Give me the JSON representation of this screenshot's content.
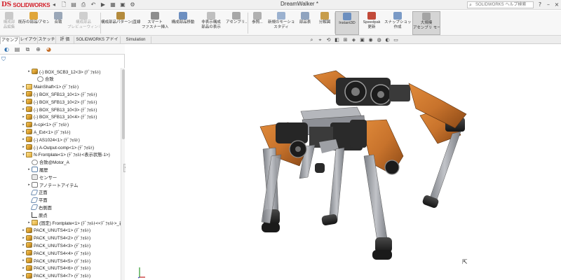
{
  "app": {
    "logo_ds": "DS",
    "logo_name": "SOLIDWORKS",
    "document_title": "DreamWalker *",
    "search_placeholder": "SOLIDWORKS ヘルプ検索"
  },
  "quick_access": [
    {
      "icon": "arrow-left-icon",
      "glyph": "◂"
    },
    {
      "icon": "new-doc-icon",
      "glyph": "🗋"
    },
    {
      "icon": "open-icon",
      "glyph": "▤"
    },
    {
      "icon": "print-icon",
      "glyph": "⎙"
    },
    {
      "icon": "undo-icon",
      "glyph": "↶"
    },
    {
      "icon": "select-icon",
      "glyph": "▶"
    },
    {
      "icon": "rebuild-icon",
      "glyph": "▦"
    },
    {
      "icon": "save-icon",
      "glyph": "▣"
    },
    {
      "icon": "options-icon",
      "glyph": "⚙"
    }
  ],
  "ribbon": {
    "buttons": [
      {
        "id": "edit-component",
        "line1": "構成部",
        "line2": "品編集",
        "disabled": true,
        "icon_color": "#c9c9c9"
      },
      {
        "id": "insert-component",
        "line1": "既存の部品/アセンブリ",
        "line2": "",
        "disabled": false,
        "icon_color": "#e0a63a"
      },
      {
        "id": "mate",
        "line1": "合致",
        "line2": "",
        "disabled": false,
        "icon_color": "#9aa7b8"
      },
      {
        "id": "component-preview",
        "line1": "構成部品",
        "line2": "プレビューウィンドウ",
        "disabled": true,
        "icon_color": "#cfcfcf"
      },
      {
        "id": "linear-pattern",
        "line1": "構成部品パターン(直線パターン)",
        "line2": "",
        "disabled": false,
        "icon_color": "#b48b3d"
      },
      {
        "id": "smart-fasteners",
        "line1": "スマート",
        "line2": "ファスナー挿入",
        "disabled": false,
        "icon_color": "#8d8d8d"
      },
      {
        "id": "move-component",
        "line1": "構成部品移動",
        "line2": "",
        "disabled": false,
        "icon_color": "#6d8fc0"
      },
      {
        "id": "show-hidden",
        "line1": "非表示構成",
        "line2": "部品の表示",
        "disabled": false,
        "icon_color": "#bfbfbf"
      },
      {
        "id": "assembly-features",
        "line1": "アセンブリ...",
        "line2": "",
        "disabled": false,
        "icon_color": "#a7a7a7"
      },
      {
        "id": "reference",
        "line1": "参照...",
        "line2": "",
        "disabled": false,
        "icon_color": "#b0b0b0"
      },
      {
        "id": "new-motion-study",
        "line1": "新規のモーション",
        "line2": "スタディ",
        "disabled": false,
        "icon_color": "#9bb1cf"
      },
      {
        "id": "bom",
        "line1": "部品表",
        "line2": "",
        "disabled": false,
        "icon_color": "#8fa3bf"
      },
      {
        "id": "exploded-view",
        "line1": "分解図",
        "line2": "",
        "disabled": false,
        "icon_color": "#c79d4b"
      },
      {
        "id": "instant3d",
        "line1": "Instant3D",
        "line2": "",
        "disabled": false,
        "icon_color": "#6c8fbf",
        "active": true
      },
      {
        "id": "speedpak",
        "line1": "Speedpak",
        "line2": "更新",
        "disabled": false,
        "icon_color": "#c24a3a"
      },
      {
        "id": "snapshot",
        "line1": "スナップショット",
        "line2": "作成",
        "disabled": false,
        "icon_color": "#7a9ac6"
      },
      {
        "id": "large-assembly",
        "line1": "大規模",
        "line2": "アセンブリ モード",
        "disabled": false,
        "icon_color": "#a4a4a4",
        "active": true
      }
    ]
  },
  "tabs": [
    "アセンブリ",
    "レイアウト",
    "スケッチ",
    "評 価",
    "SOLIDWORKS アドイン",
    "Simulation"
  ],
  "panel_tabs": [
    {
      "icon": "feature-manager-icon",
      "glyph": "◐",
      "color": "#2e6fae"
    },
    {
      "icon": "property-manager-icon",
      "glyph": "▤",
      "color": "#555"
    },
    {
      "icon": "configuration-manager-icon",
      "glyph": "⧉",
      "color": "#555"
    },
    {
      "icon": "dimxpert-icon",
      "glyph": "⊕",
      "color": "#555"
    },
    {
      "icon": "display-manager-icon",
      "glyph": "◕",
      "color": "#c46f2a"
    }
  ],
  "tree": [
    {
      "label": "(-) BOX_SCB3_12<3> (ﾃﾞﾌｫﾙﾄ)",
      "indent": 1,
      "arrow": "▸",
      "icon": "asm"
    },
    {
      "label": "合致",
      "indent": 2,
      "arrow": "",
      "icon": "mate"
    },
    {
      "label": "MainShaft<1> (ﾃﾞﾌｫﾙﾄ)",
      "indent": 0,
      "arrow": "▸",
      "icon": "part"
    },
    {
      "label": "(-) BOX_SFB13_10<1> (ﾃﾞﾌｫﾙﾄ)",
      "indent": 0,
      "arrow": "▸",
      "icon": "asm"
    },
    {
      "label": "(-) BOX_SFB13_10<2> (ﾃﾞﾌｫﾙﾄ)",
      "indent": 0,
      "arrow": "▸",
      "icon": "asm"
    },
    {
      "label": "(-) BOX_SFB13_10<3> (ﾃﾞﾌｫﾙﾄ)",
      "indent": 0,
      "arrow": "▸",
      "icon": "asm"
    },
    {
      "label": "(-) BOX_SFB13_10<4> (ﾃﾞﾌｫﾙﾄ)",
      "indent": 0,
      "arrow": "▸",
      "icon": "asm"
    },
    {
      "label": "A-cpi<1> (ﾃﾞﾌｫﾙﾄ)",
      "indent": 0,
      "arrow": "▸",
      "icon": "asm"
    },
    {
      "label": "A_Ext<1> (ﾃﾞﾌｫﾙﾄ)",
      "indent": 0,
      "arrow": "▸",
      "icon": "asm"
    },
    {
      "label": "(-) AS1024<1> (ﾃﾞﾌｫﾙﾄ)",
      "indent": 0,
      "arrow": "▸",
      "icon": "asm"
    },
    {
      "label": "(-) A-Output-comp<1> (ﾃﾞﾌｫﾙﾄ)",
      "indent": 0,
      "arrow": "▸",
      "icon": "asm"
    },
    {
      "label": "N-Frontplate<1> (ﾃﾞﾌｫﾙﾄ<表示状態-1>)",
      "indent": 0,
      "arrow": "▾",
      "icon": "part"
    },
    {
      "label": "合致@Motor_A",
      "indent": 1,
      "arrow": "",
      "icon": "mate"
    },
    {
      "label": "履歴",
      "indent": 1,
      "arrow": "▸",
      "icon": "hist"
    },
    {
      "label": "センサー",
      "indent": 1,
      "arrow": "",
      "icon": "sens"
    },
    {
      "label": "アノテートアイテム",
      "indent": 1,
      "arrow": "▸",
      "icon": "note"
    },
    {
      "label": "正面",
      "indent": 1,
      "arrow": "",
      "icon": "plane"
    },
    {
      "label": "平面",
      "indent": 1,
      "arrow": "",
      "icon": "plane"
    },
    {
      "label": "右側面",
      "indent": 1,
      "arrow": "",
      "icon": "plane"
    },
    {
      "label": "原点",
      "indent": 1,
      "arrow": "",
      "icon": "origin"
    },
    {
      "label": "(固定) Frontplate<1> (ﾃﾞﾌｫﾙﾄ<<ﾃﾞﾌｫﾙﾄ>_表",
      "indent": 1,
      "arrow": "▸",
      "icon": "part"
    },
    {
      "label": "PACK_UNUTS4<1> (ﾃﾞﾌｫﾙﾄ)",
      "indent": 0,
      "arrow": "▸",
      "icon": "asm"
    },
    {
      "label": "PACK_UNUTS4<2> (ﾃﾞﾌｫﾙﾄ)",
      "indent": 0,
      "arrow": "▸",
      "icon": "asm"
    },
    {
      "label": "PACK_UNUTS4<3> (ﾃﾞﾌｫﾙﾄ)",
      "indent": 0,
      "arrow": "▸",
      "icon": "asm"
    },
    {
      "label": "PACK_UNUTS4<4> (ﾃﾞﾌｫﾙﾄ)",
      "indent": 0,
      "arrow": "▸",
      "icon": "asm"
    },
    {
      "label": "PACK_UNUTS4<5> (ﾃﾞﾌｫﾙﾄ)",
      "indent": 0,
      "arrow": "▸",
      "icon": "asm"
    },
    {
      "label": "PACK_UNUTS4<6> (ﾃﾞﾌｫﾙﾄ)",
      "indent": 0,
      "arrow": "▸",
      "icon": "asm"
    },
    {
      "label": "PACK_UNUTS4<7> (ﾃﾞﾌｫﾙﾄ)",
      "indent": 0,
      "arrow": "▸",
      "icon": "asm"
    }
  ],
  "view_toolbar": [
    {
      "icon": "zoom-to-fit-icon",
      "glyph": "⌕"
    },
    {
      "icon": "zoom-area-icon",
      "glyph": "⌖"
    },
    {
      "icon": "previous-view-icon",
      "glyph": "⟲"
    },
    {
      "icon": "section-view-icon",
      "glyph": "◧"
    },
    {
      "icon": "dynamic-annotation-icon",
      "glyph": "⊞"
    },
    {
      "icon": "view-orientation-icon",
      "glyph": "◈"
    },
    {
      "icon": "display-style-icon",
      "glyph": "▣"
    },
    {
      "icon": "hide-show-icon",
      "glyph": "◉"
    },
    {
      "icon": "appearance-icon",
      "glyph": "◍"
    },
    {
      "icon": "scene-icon",
      "glyph": "◐"
    },
    {
      "icon": "view-settings-icon",
      "glyph": "▭"
    }
  ],
  "colors": {
    "accent_orange": "#c8732c",
    "dark_metal": "#2a2a2a",
    "light_metal": "#a4a6ab",
    "brand_red": "#d3202a"
  }
}
